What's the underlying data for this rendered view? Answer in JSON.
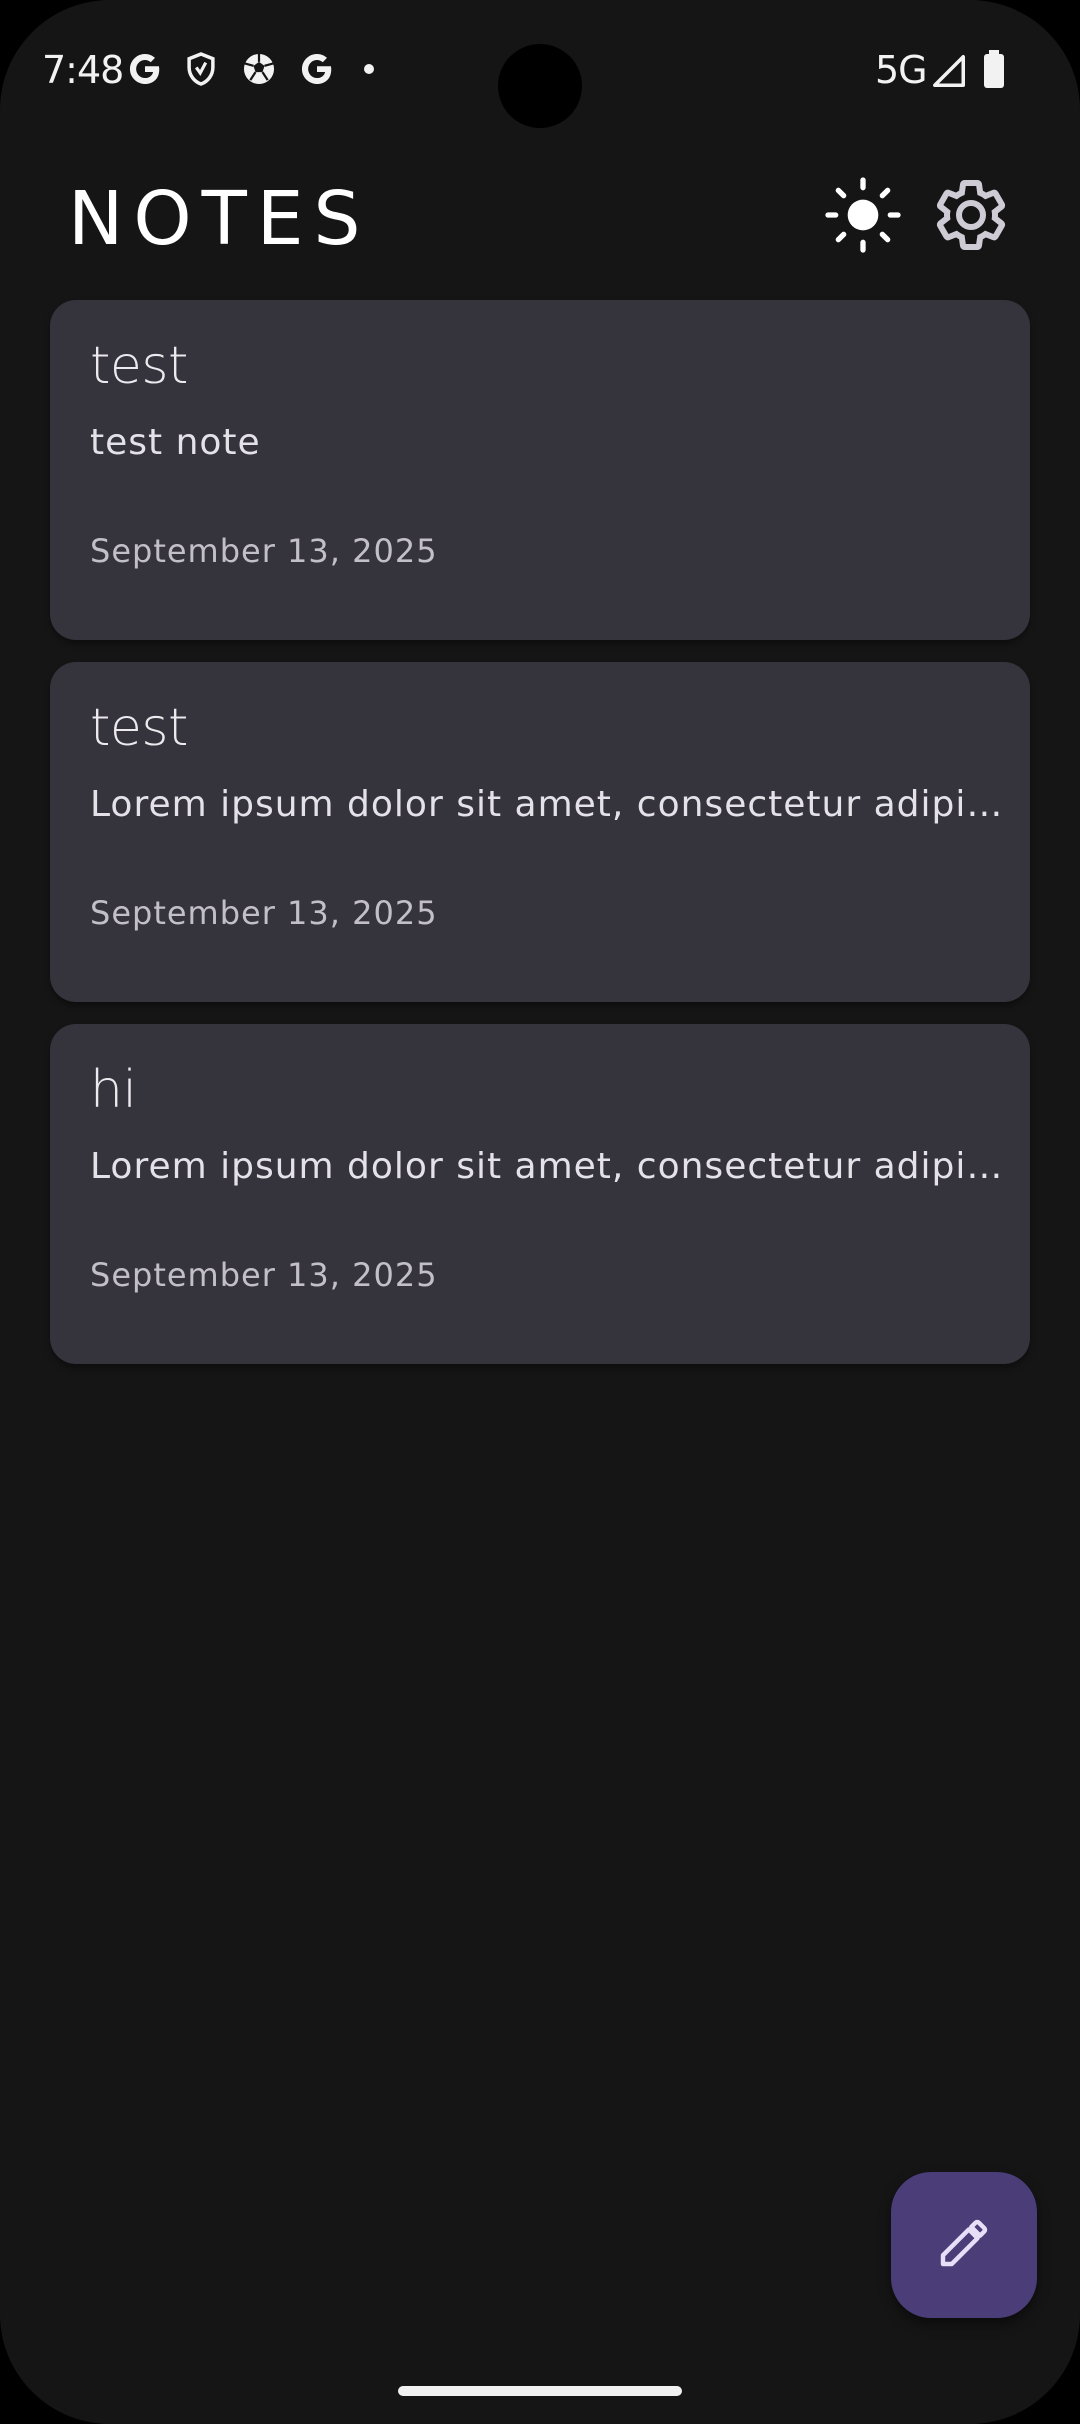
{
  "status_bar": {
    "time": "7:48",
    "network": "5G",
    "icons": [
      "google-icon",
      "shield-icon",
      "soccer-ball-icon",
      "google-icon",
      "dot-icon",
      "signal-icon",
      "battery-icon"
    ]
  },
  "header": {
    "title": "NOTES",
    "theme_icon": "sun-icon",
    "settings_icon": "gear-icon"
  },
  "notes": [
    {
      "title": "test",
      "body": "test note",
      "date": "September 13, 2025"
    },
    {
      "title": "test",
      "body": "Lorem ipsum dolor sit amet, consectetur adipisc...",
      "date": "September 13, 2025"
    },
    {
      "title": "hi",
      "body": "Lorem ipsum dolor sit amet, consectetur adipisc...",
      "date": "September 13, 2025"
    }
  ],
  "fab": {
    "icon": "pencil-icon"
  },
  "colors": {
    "background": "#151515",
    "card": "#35333b",
    "fab": "#4a3d78",
    "accent_icon": "#d9d2ef"
  }
}
